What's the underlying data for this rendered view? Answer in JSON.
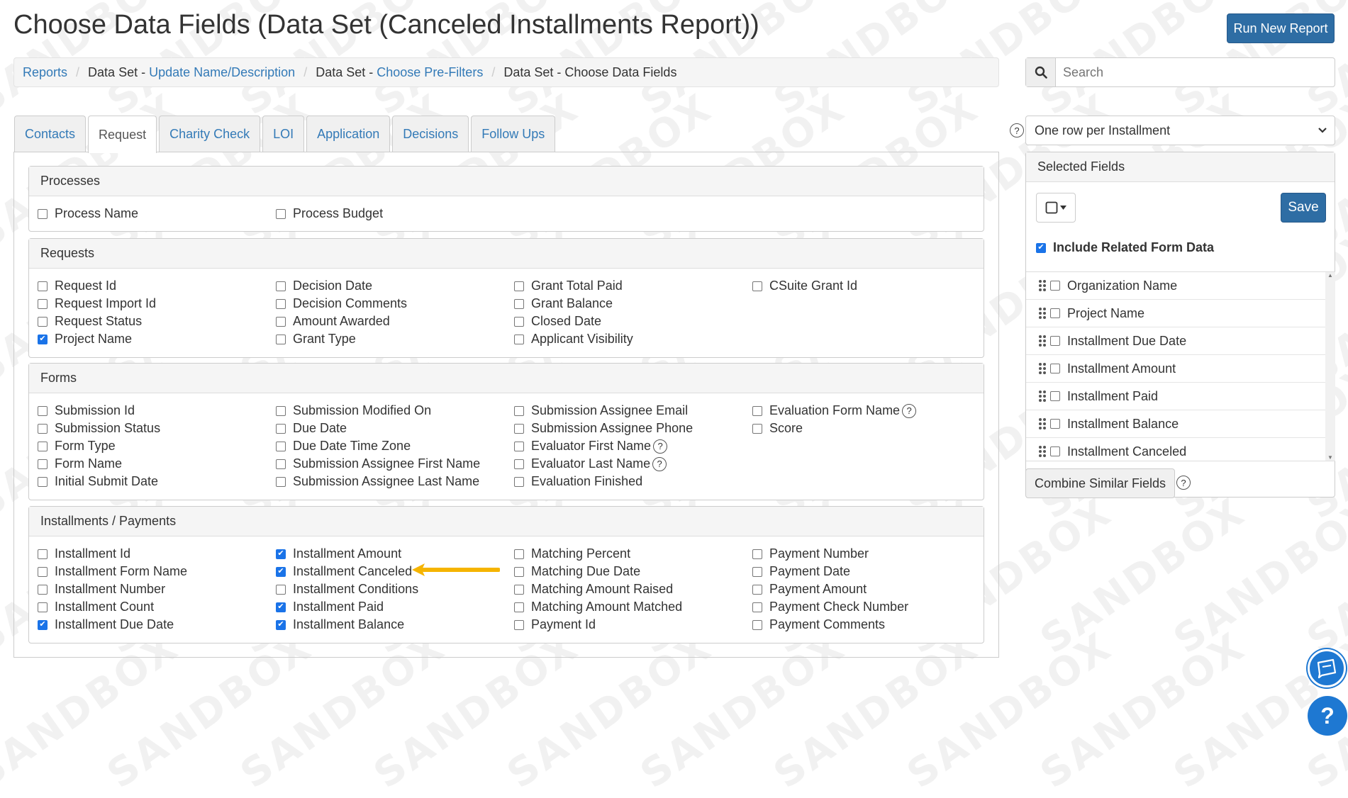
{
  "page": {
    "title": "Choose Data Fields (Data Set (Canceled Installments Report))",
    "watermark": "SANDBOX"
  },
  "header": {
    "run_report_label": "Run New Report"
  },
  "breadcrumb": {
    "item1": "Reports",
    "item2_prefix": "Data Set - ",
    "item2_link": "Update Name/Description",
    "item3_prefix": "Data Set - ",
    "item3_link": "Choose Pre-Filters",
    "item4": "Data Set - Choose Data Fields"
  },
  "search": {
    "placeholder": "Search"
  },
  "tabs": [
    {
      "label": "Contacts"
    },
    {
      "label": "Request"
    },
    {
      "label": "Charity Check"
    },
    {
      "label": "LOI"
    },
    {
      "label": "Application"
    },
    {
      "label": "Decisions"
    },
    {
      "label": "Follow Ups"
    }
  ],
  "active_tab": "Request",
  "sections": {
    "processes": {
      "title": "Processes",
      "col1": [
        {
          "label": "Process Name",
          "checked": false
        }
      ],
      "col2": [
        {
          "label": "Process Budget",
          "checked": false
        }
      ]
    },
    "requests": {
      "title": "Requests",
      "col1": [
        {
          "label": "Request Id",
          "checked": false
        },
        {
          "label": "Request Import Id",
          "checked": false
        },
        {
          "label": "Request Status",
          "checked": false
        },
        {
          "label": "Project Name",
          "checked": true
        }
      ],
      "col2": [
        {
          "label": "Decision Date",
          "checked": false
        },
        {
          "label": "Decision Comments",
          "checked": false
        },
        {
          "label": "Amount Awarded",
          "checked": false
        },
        {
          "label": "Grant Type",
          "checked": false
        }
      ],
      "col3": [
        {
          "label": "Grant Total Paid",
          "checked": false
        },
        {
          "label": "Grant Balance",
          "checked": false
        },
        {
          "label": "Closed Date",
          "checked": false
        },
        {
          "label": "Applicant Visibility",
          "checked": false
        }
      ],
      "col4": [
        {
          "label": "CSuite Grant Id",
          "checked": false
        }
      ]
    },
    "forms": {
      "title": "Forms",
      "col1": [
        {
          "label": "Submission Id",
          "checked": false
        },
        {
          "label": "Submission Status",
          "checked": false
        },
        {
          "label": "Form Type",
          "checked": false
        },
        {
          "label": "Form Name",
          "checked": false
        },
        {
          "label": "Initial Submit Date",
          "checked": false
        }
      ],
      "col2": [
        {
          "label": "Submission Modified On",
          "checked": false
        },
        {
          "label": "Due Date",
          "checked": false
        },
        {
          "label": "Due Date Time Zone",
          "checked": false
        },
        {
          "label": "Submission Assignee First Name",
          "checked": false
        },
        {
          "label": "Submission Assignee Last Name",
          "checked": false
        }
      ],
      "col3": [
        {
          "label": "Submission Assignee Email",
          "checked": false
        },
        {
          "label": "Submission Assignee Phone",
          "checked": false
        },
        {
          "label": "Evaluator First Name",
          "checked": false,
          "help": true
        },
        {
          "label": "Evaluator Last Name",
          "checked": false,
          "help": true
        },
        {
          "label": "Evaluation Finished",
          "checked": false
        }
      ],
      "col4": [
        {
          "label": "Evaluation Form Name",
          "checked": false,
          "help": true
        },
        {
          "label": "Score",
          "checked": false
        }
      ]
    },
    "installments": {
      "title": "Installments / Payments",
      "col1": [
        {
          "label": "Installment Id",
          "checked": false
        },
        {
          "label": "Installment Form Name",
          "checked": false
        },
        {
          "label": "Installment Number",
          "checked": false
        },
        {
          "label": "Installment Count",
          "checked": false
        },
        {
          "label": "Installment Due Date",
          "checked": true
        }
      ],
      "col2": [
        {
          "label": "Installment Amount",
          "checked": true
        },
        {
          "label": "Installment Canceled",
          "checked": true
        },
        {
          "label": "Installment Conditions",
          "checked": false
        },
        {
          "label": "Installment Paid",
          "checked": true
        },
        {
          "label": "Installment Balance",
          "checked": true
        }
      ],
      "col3": [
        {
          "label": "Matching Percent",
          "checked": false
        },
        {
          "label": "Matching Due Date",
          "checked": false
        },
        {
          "label": "Matching Amount Raised",
          "checked": false
        },
        {
          "label": "Matching Amount Matched",
          "checked": false
        },
        {
          "label": "Payment Id",
          "checked": false
        }
      ],
      "col4": [
        {
          "label": "Payment Number",
          "checked": false
        },
        {
          "label": "Payment Date",
          "checked": false
        },
        {
          "label": "Payment Amount",
          "checked": false
        },
        {
          "label": "Payment Check Number",
          "checked": false
        },
        {
          "label": "Payment Comments",
          "checked": false
        }
      ]
    }
  },
  "row_mode": {
    "selected": "One row per Installment"
  },
  "selected_fields": {
    "title": "Selected Fields",
    "save_label": "Save",
    "include_related_label": "Include Related Form Data",
    "include_related_checked": true,
    "items": [
      {
        "label": "Organization Name"
      },
      {
        "label": "Project Name"
      },
      {
        "label": "Installment Due Date"
      },
      {
        "label": "Installment Amount"
      },
      {
        "label": "Installment Paid"
      },
      {
        "label": "Installment Balance"
      },
      {
        "label": "Installment Canceled"
      }
    ],
    "combine_label": "Combine Similar Fields"
  },
  "colors": {
    "primary": "#2e6da4",
    "link": "#337ab7",
    "checkbox": "#1a73e8",
    "arrow": "#f5b400",
    "fab": "#1e78d2"
  },
  "help_icon_glyph": "?",
  "fab_help_glyph": "?"
}
